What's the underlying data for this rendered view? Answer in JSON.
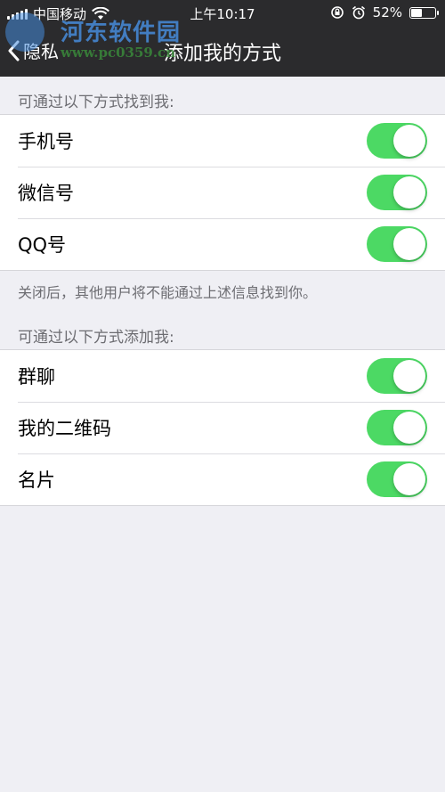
{
  "status_bar": {
    "carrier": "中国移动",
    "time": "上午10:17",
    "battery": "52%",
    "battery_level": 0.52,
    "icons": [
      "signal-icon",
      "wifi-icon",
      "rotation-lock-icon",
      "alarm-icon",
      "battery-icon"
    ]
  },
  "nav": {
    "back_label": "隐私",
    "title": "添加我的方式"
  },
  "watermark": {
    "brand": "河东软件园",
    "url": "www.pc0359.cn"
  },
  "find_section": {
    "header": "可通过以下方式找到我:",
    "footer": "关闭后，其他用户将不能通过上述信息找到你。",
    "items": [
      {
        "label": "手机号",
        "on": true
      },
      {
        "label": "微信号",
        "on": true
      },
      {
        "label": "QQ号",
        "on": true
      }
    ]
  },
  "add_section": {
    "header": "可通过以下方式添加我:",
    "items": [
      {
        "label": "群聊",
        "on": true
      },
      {
        "label": "我的二维码",
        "on": true
      },
      {
        "label": "名片",
        "on": true
      }
    ]
  },
  "colors": {
    "nav_bg": "#2b2b2d",
    "page_bg": "#efeff4",
    "toggle_on": "#4cd964"
  }
}
